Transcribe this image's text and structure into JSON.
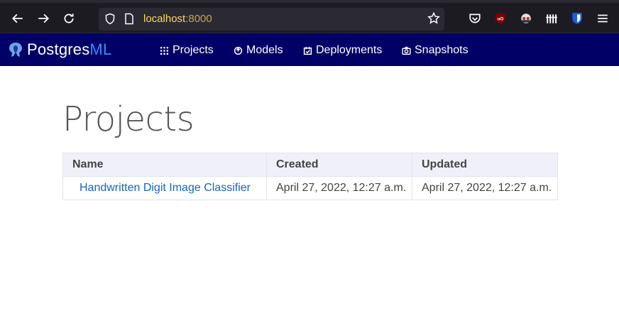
{
  "browser": {
    "url_host": "localhost",
    "url_port": ":8000"
  },
  "app": {
    "brand_main": "Postgres",
    "brand_accent": "ML",
    "brand_color": "#000066",
    "accent_color": "#3b8cff",
    "nav": [
      {
        "label": "Projects",
        "icon": "grid-icon"
      },
      {
        "label": "Models",
        "icon": "model-icon"
      },
      {
        "label": "Deployments",
        "icon": "deployments-icon"
      },
      {
        "label": "Snapshots",
        "icon": "camera-icon"
      }
    ]
  },
  "page": {
    "title": "Projects",
    "table": {
      "columns": [
        "Name",
        "Created",
        "Updated"
      ],
      "rows": [
        [
          "Handwritten Digit Image Classifier",
          "April 27, 2022, 12:27 a.m.",
          "April 27, 2022, 12:27 a.m."
        ]
      ]
    }
  }
}
